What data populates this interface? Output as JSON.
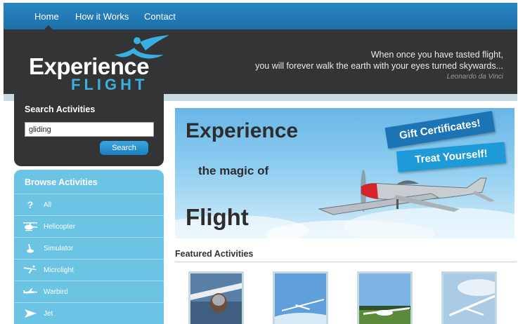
{
  "nav": {
    "items": [
      "Home",
      "How it Works",
      "Contact"
    ],
    "active": "Home"
  },
  "logo": {
    "line1": "Experience",
    "line2": "FLIGHT"
  },
  "quote": {
    "line1": "When once you have tasted flight,",
    "line2": "you will forever walk the earth with your eyes turned skywards...",
    "author": "Leonardo da Vinci"
  },
  "search": {
    "title": "Search Activities",
    "value": "gliding",
    "button_label": "Search"
  },
  "browse": {
    "title": "Browse Activities",
    "items": [
      {
        "label": "All",
        "icon": "question-mark-icon"
      },
      {
        "label": "Helicopter",
        "icon": "helicopter-icon"
      },
      {
        "label": "Simulator",
        "icon": "joystick-icon"
      },
      {
        "label": "Microlight",
        "icon": "microlight-icon"
      },
      {
        "label": "Warbird",
        "icon": "warbird-plane-icon"
      },
      {
        "label": "Jet",
        "icon": "jet-icon"
      }
    ]
  },
  "banner": {
    "line1": "Experience",
    "line2": "the magic of",
    "line3": "Flight",
    "gift_label": "Gift Certificates!",
    "treat_label": "Treat Yourself!"
  },
  "featured": {
    "title": "Featured Activities"
  },
  "colors": {
    "nav_blue": "#1d6fa8",
    "header_dark": "#333435",
    "accent_cyan": "#3ab0e2",
    "browse_bg": "#6cc4e4"
  }
}
